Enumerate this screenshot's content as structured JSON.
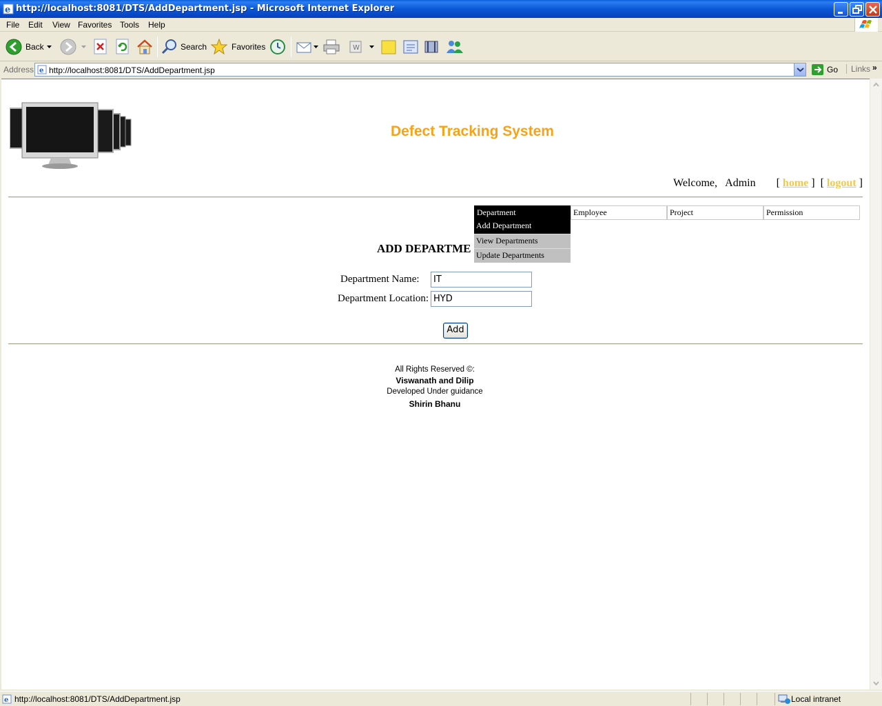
{
  "window": {
    "title": "http://localhost:8081/DTS/AddDepartment.jsp - Microsoft Internet Explorer"
  },
  "menubar": {
    "items": [
      "File",
      "Edit",
      "View",
      "Favorites",
      "Tools",
      "Help"
    ]
  },
  "toolbar": {
    "back_label": "Back",
    "search_label": "Search",
    "favorites_label": "Favorites"
  },
  "addressbar": {
    "label": "Address",
    "url": "http://localhost:8081/DTS/AddDepartment.jsp",
    "go_label": "Go",
    "links_label": "Links"
  },
  "page": {
    "site_title": "Defect Tracking System",
    "welcome_text": "Welcome,",
    "user_name": "Admin",
    "home_link": "home",
    "logout_link": "logout",
    "nav": {
      "tabs": [
        "Department",
        "Employee",
        "Project",
        "Permission"
      ],
      "department_menu": [
        "Add Department",
        "View Departments",
        "Update Departments"
      ]
    },
    "heading": "ADD DEPARTME",
    "form": {
      "name_label": "Department Name:",
      "name_value": "IT",
      "location_label": "Department Location:",
      "location_value": "HYD",
      "submit_label": "Add"
    },
    "footer": {
      "line1": "All Rights Reserved ©:",
      "line2": "Viswanath and Dilip",
      "line3": "Developed Under guidance",
      "line4": "Shirin Bhanu"
    }
  },
  "statusbar": {
    "text": "http://localhost:8081/DTS/AddDepartment.jsp",
    "zone": "Local intranet"
  },
  "colors": {
    "title_orange": "#f5a31a",
    "link_yellow": "#f5c842",
    "menu_active": "#000000",
    "menu_item_bg": "#c0c0c0"
  }
}
